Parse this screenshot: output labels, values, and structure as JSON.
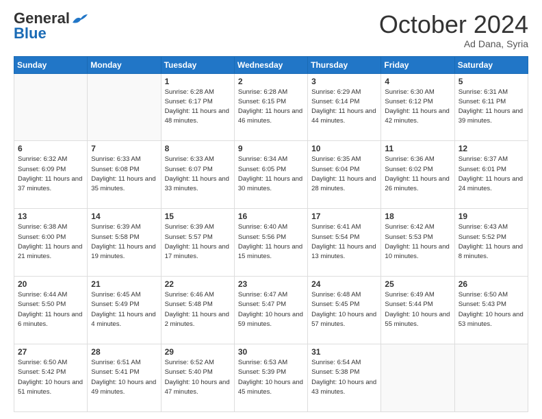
{
  "header": {
    "logo_line1": "General",
    "logo_line2": "Blue",
    "month": "October 2024",
    "location": "Ad Dana, Syria"
  },
  "weekdays": [
    "Sunday",
    "Monday",
    "Tuesday",
    "Wednesday",
    "Thursday",
    "Friday",
    "Saturday"
  ],
  "days": [
    {
      "num": "",
      "sunrise": "",
      "sunset": "",
      "daylight": ""
    },
    {
      "num": "",
      "sunrise": "",
      "sunset": "",
      "daylight": ""
    },
    {
      "num": "1",
      "sunrise": "Sunrise: 6:28 AM",
      "sunset": "Sunset: 6:17 PM",
      "daylight": "Daylight: 11 hours and 48 minutes."
    },
    {
      "num": "2",
      "sunrise": "Sunrise: 6:28 AM",
      "sunset": "Sunset: 6:15 PM",
      "daylight": "Daylight: 11 hours and 46 minutes."
    },
    {
      "num": "3",
      "sunrise": "Sunrise: 6:29 AM",
      "sunset": "Sunset: 6:14 PM",
      "daylight": "Daylight: 11 hours and 44 minutes."
    },
    {
      "num": "4",
      "sunrise": "Sunrise: 6:30 AM",
      "sunset": "Sunset: 6:12 PM",
      "daylight": "Daylight: 11 hours and 42 minutes."
    },
    {
      "num": "5",
      "sunrise": "Sunrise: 6:31 AM",
      "sunset": "Sunset: 6:11 PM",
      "daylight": "Daylight: 11 hours and 39 minutes."
    },
    {
      "num": "6",
      "sunrise": "Sunrise: 6:32 AM",
      "sunset": "Sunset: 6:09 PM",
      "daylight": "Daylight: 11 hours and 37 minutes."
    },
    {
      "num": "7",
      "sunrise": "Sunrise: 6:33 AM",
      "sunset": "Sunset: 6:08 PM",
      "daylight": "Daylight: 11 hours and 35 minutes."
    },
    {
      "num": "8",
      "sunrise": "Sunrise: 6:33 AM",
      "sunset": "Sunset: 6:07 PM",
      "daylight": "Daylight: 11 hours and 33 minutes."
    },
    {
      "num": "9",
      "sunrise": "Sunrise: 6:34 AM",
      "sunset": "Sunset: 6:05 PM",
      "daylight": "Daylight: 11 hours and 30 minutes."
    },
    {
      "num": "10",
      "sunrise": "Sunrise: 6:35 AM",
      "sunset": "Sunset: 6:04 PM",
      "daylight": "Daylight: 11 hours and 28 minutes."
    },
    {
      "num": "11",
      "sunrise": "Sunrise: 6:36 AM",
      "sunset": "Sunset: 6:02 PM",
      "daylight": "Daylight: 11 hours and 26 minutes."
    },
    {
      "num": "12",
      "sunrise": "Sunrise: 6:37 AM",
      "sunset": "Sunset: 6:01 PM",
      "daylight": "Daylight: 11 hours and 24 minutes."
    },
    {
      "num": "13",
      "sunrise": "Sunrise: 6:38 AM",
      "sunset": "Sunset: 6:00 PM",
      "daylight": "Daylight: 11 hours and 21 minutes."
    },
    {
      "num": "14",
      "sunrise": "Sunrise: 6:39 AM",
      "sunset": "Sunset: 5:58 PM",
      "daylight": "Daylight: 11 hours and 19 minutes."
    },
    {
      "num": "15",
      "sunrise": "Sunrise: 6:39 AM",
      "sunset": "Sunset: 5:57 PM",
      "daylight": "Daylight: 11 hours and 17 minutes."
    },
    {
      "num": "16",
      "sunrise": "Sunrise: 6:40 AM",
      "sunset": "Sunset: 5:56 PM",
      "daylight": "Daylight: 11 hours and 15 minutes."
    },
    {
      "num": "17",
      "sunrise": "Sunrise: 6:41 AM",
      "sunset": "Sunset: 5:54 PM",
      "daylight": "Daylight: 11 hours and 13 minutes."
    },
    {
      "num": "18",
      "sunrise": "Sunrise: 6:42 AM",
      "sunset": "Sunset: 5:53 PM",
      "daylight": "Daylight: 11 hours and 10 minutes."
    },
    {
      "num": "19",
      "sunrise": "Sunrise: 6:43 AM",
      "sunset": "Sunset: 5:52 PM",
      "daylight": "Daylight: 11 hours and 8 minutes."
    },
    {
      "num": "20",
      "sunrise": "Sunrise: 6:44 AM",
      "sunset": "Sunset: 5:50 PM",
      "daylight": "Daylight: 11 hours and 6 minutes."
    },
    {
      "num": "21",
      "sunrise": "Sunrise: 6:45 AM",
      "sunset": "Sunset: 5:49 PM",
      "daylight": "Daylight: 11 hours and 4 minutes."
    },
    {
      "num": "22",
      "sunrise": "Sunrise: 6:46 AM",
      "sunset": "Sunset: 5:48 PM",
      "daylight": "Daylight: 11 hours and 2 minutes."
    },
    {
      "num": "23",
      "sunrise": "Sunrise: 6:47 AM",
      "sunset": "Sunset: 5:47 PM",
      "daylight": "Daylight: 10 hours and 59 minutes."
    },
    {
      "num": "24",
      "sunrise": "Sunrise: 6:48 AM",
      "sunset": "Sunset: 5:45 PM",
      "daylight": "Daylight: 10 hours and 57 minutes."
    },
    {
      "num": "25",
      "sunrise": "Sunrise: 6:49 AM",
      "sunset": "Sunset: 5:44 PM",
      "daylight": "Daylight: 10 hours and 55 minutes."
    },
    {
      "num": "26",
      "sunrise": "Sunrise: 6:50 AM",
      "sunset": "Sunset: 5:43 PM",
      "daylight": "Daylight: 10 hours and 53 minutes."
    },
    {
      "num": "27",
      "sunrise": "Sunrise: 6:50 AM",
      "sunset": "Sunset: 5:42 PM",
      "daylight": "Daylight: 10 hours and 51 minutes."
    },
    {
      "num": "28",
      "sunrise": "Sunrise: 6:51 AM",
      "sunset": "Sunset: 5:41 PM",
      "daylight": "Daylight: 10 hours and 49 minutes."
    },
    {
      "num": "29",
      "sunrise": "Sunrise: 6:52 AM",
      "sunset": "Sunset: 5:40 PM",
      "daylight": "Daylight: 10 hours and 47 minutes."
    },
    {
      "num": "30",
      "sunrise": "Sunrise: 6:53 AM",
      "sunset": "Sunset: 5:39 PM",
      "daylight": "Daylight: 10 hours and 45 minutes."
    },
    {
      "num": "31",
      "sunrise": "Sunrise: 6:54 AM",
      "sunset": "Sunset: 5:38 PM",
      "daylight": "Daylight: 10 hours and 43 minutes."
    },
    {
      "num": "",
      "sunrise": "",
      "sunset": "",
      "daylight": ""
    },
    {
      "num": "",
      "sunrise": "",
      "sunset": "",
      "daylight": ""
    },
    {
      "num": "",
      "sunrise": "",
      "sunset": "",
      "daylight": ""
    }
  ]
}
